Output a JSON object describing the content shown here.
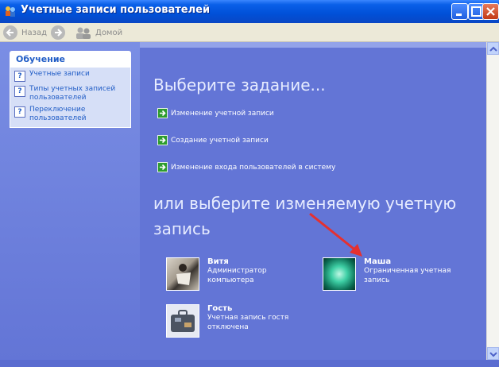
{
  "window": {
    "title": "Учетные записи пользователей"
  },
  "toolbar": {
    "back_label": "Назад",
    "home_label": "Домой"
  },
  "sidebar": {
    "section_title": "Обучение",
    "items": [
      {
        "label": "Учетные записи"
      },
      {
        "label": "Типы учетных записей пользователей"
      },
      {
        "label": "Переключение пользователей"
      }
    ]
  },
  "main": {
    "heading_tasks": "Выберите задание...",
    "tasks": [
      {
        "label": "Изменение учетной записи"
      },
      {
        "label": "Создание учетной записи"
      },
      {
        "label": "Изменение входа пользователей в систему"
      }
    ],
    "heading_accounts": "или выберите изменяемую учетную запись",
    "accounts": [
      {
        "name": "Витя",
        "desc": "Администратор компьютера"
      },
      {
        "name": "Маша",
        "desc": "Ограниченная учетная запись"
      },
      {
        "name": "Гость",
        "desc": "Учетная запись гостя отключена"
      }
    ]
  },
  "colors": {
    "background": "#6375d6",
    "titlebar": "#0050d8",
    "highlight_arrow": "#e53030"
  }
}
